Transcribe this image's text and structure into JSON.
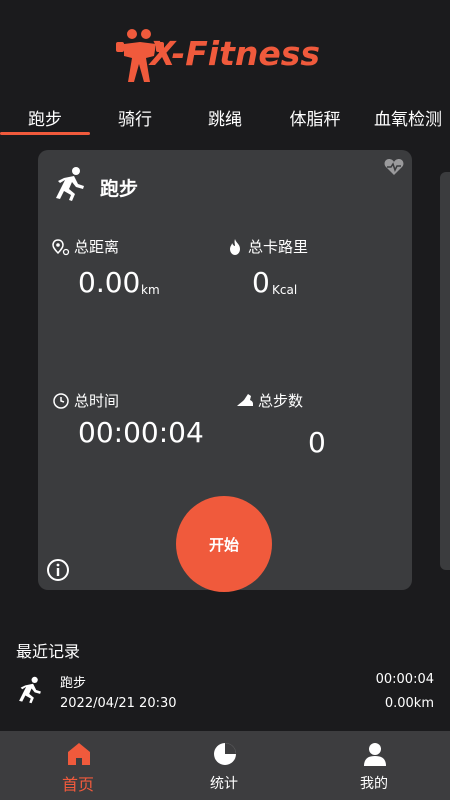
{
  "header": {
    "logo_text": "X-Fitness"
  },
  "tabs": [
    {
      "label": "跑步",
      "active": true
    },
    {
      "label": "骑行"
    },
    {
      "label": "跳绳"
    },
    {
      "label": "体脂秤"
    },
    {
      "label": "血氧检测"
    }
  ],
  "card": {
    "title": "跑步",
    "distance": {
      "label": "总距离",
      "value": "0.00",
      "unit": "km"
    },
    "calories": {
      "label": "总卡路里",
      "value": "0",
      "unit": "Kcal"
    },
    "time": {
      "label": "总时间",
      "value": "00:00:04"
    },
    "steps": {
      "label": "总步数",
      "value": "0"
    },
    "start_label": "开始"
  },
  "recent": {
    "title": "最近记录",
    "records": [
      {
        "name": "跑步",
        "date": "2022/04/21 20:30",
        "duration": "00:00:04",
        "distance": "0.00km"
      }
    ]
  },
  "nav": [
    {
      "label": "首页",
      "active": true
    },
    {
      "label": "统计"
    },
    {
      "label": "我的"
    }
  ],
  "colors": {
    "accent": "#f05a3c",
    "background": "#1b1b1d",
    "card": "#3b3c3e",
    "nav": "#3d3d3f"
  }
}
